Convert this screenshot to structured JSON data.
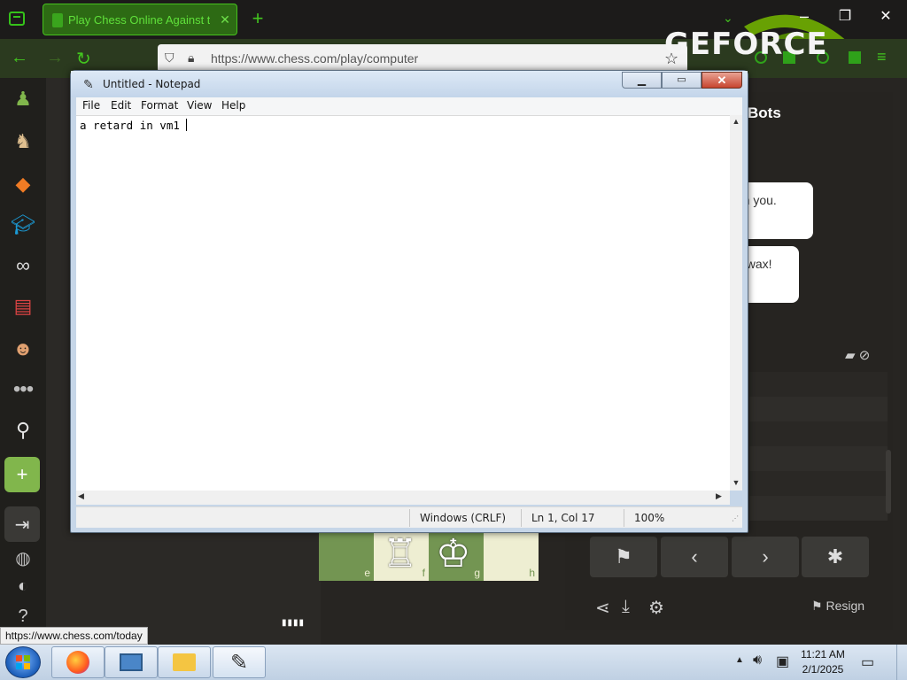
{
  "browser": {
    "tab_title": "Play Chess Online Against the",
    "tab_close": "✕",
    "new_tab": "+",
    "url": "https://www.chess.com/play/computer",
    "brand_logo": "GEFORCE",
    "window_min": "–",
    "window_max": "❐",
    "window_close": "✕",
    "accent_color": "#43c61f"
  },
  "chess_page": {
    "panel_title": "Bots",
    "bubble1": "y on you.",
    "bubble2": "eswax!",
    "board_files": [
      "e",
      "f",
      "g",
      "h"
    ],
    "resign_label": "Resign",
    "status_link": "https://www.chess.com/today"
  },
  "notepad": {
    "title": "Untitled - Notepad",
    "menu": [
      "File",
      "Edit",
      "Format",
      "View",
      "Help"
    ],
    "content": "a retard in vm1 ",
    "status_encoding": "Windows (CRLF)",
    "status_position": "Ln 1, Col 17",
    "status_zoom": "100%",
    "close_glyph": "✕"
  },
  "taskbar": {
    "time": "11:21 AM",
    "date": "2/1/2025"
  }
}
